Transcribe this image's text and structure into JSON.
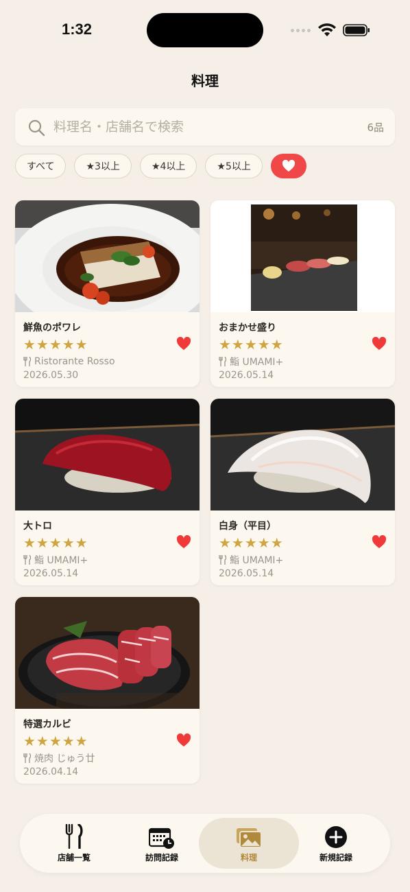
{
  "status_bar": {
    "time": "1:32"
  },
  "header": {
    "title": "料理"
  },
  "search": {
    "placeholder": "料理名・店舗名で検索",
    "value": "",
    "count": "6品"
  },
  "filters": [
    {
      "label": "すべて",
      "active": false
    },
    {
      "label": "★3以上",
      "active": false
    },
    {
      "label": "★4以上",
      "active": false
    },
    {
      "label": "★5以上",
      "active": false
    },
    {
      "label": "favorite",
      "icon": "heart-icon",
      "active": true
    }
  ],
  "dishes": [
    {
      "name": "鮮魚のポワレ",
      "rating": 5,
      "stars": "★★★★★",
      "shop": "Ristorante Rosso",
      "date": "2026.05.30",
      "favorite": true
    },
    {
      "name": "おまかせ盛り",
      "rating": 5,
      "stars": "★★★★★",
      "shop": "鮨 UMAMI+",
      "date": "2026.05.14",
      "favorite": true
    },
    {
      "name": "大トロ",
      "rating": 5,
      "stars": "★★★★★",
      "shop": "鮨 UMAMI+",
      "date": "2026.05.14",
      "favorite": true
    },
    {
      "name": "白身（平目）",
      "rating": 5,
      "stars": "★★★★★",
      "shop": "鮨 UMAMI+",
      "date": "2026.05.14",
      "favorite": true
    },
    {
      "name": "特選カルビ",
      "rating": 5,
      "stars": "★★★★★",
      "shop": "焼肉 じゅう廿",
      "date": "2026.04.14",
      "favorite": true
    }
  ],
  "tabs": [
    {
      "label": "店舗一覧",
      "icon": "fork-knife-icon",
      "active": false
    },
    {
      "label": "訪問記録",
      "icon": "calendar-clock-icon",
      "active": false
    },
    {
      "label": "料理",
      "icon": "photos-icon",
      "active": true
    },
    {
      "label": "新規記録",
      "icon": "plus-circle-icon",
      "active": false
    }
  ],
  "colors": {
    "background": "#f5efe7",
    "accent_red": "#f04848",
    "star_gold": "#cfa544",
    "active_tab": "#b08a3a"
  }
}
